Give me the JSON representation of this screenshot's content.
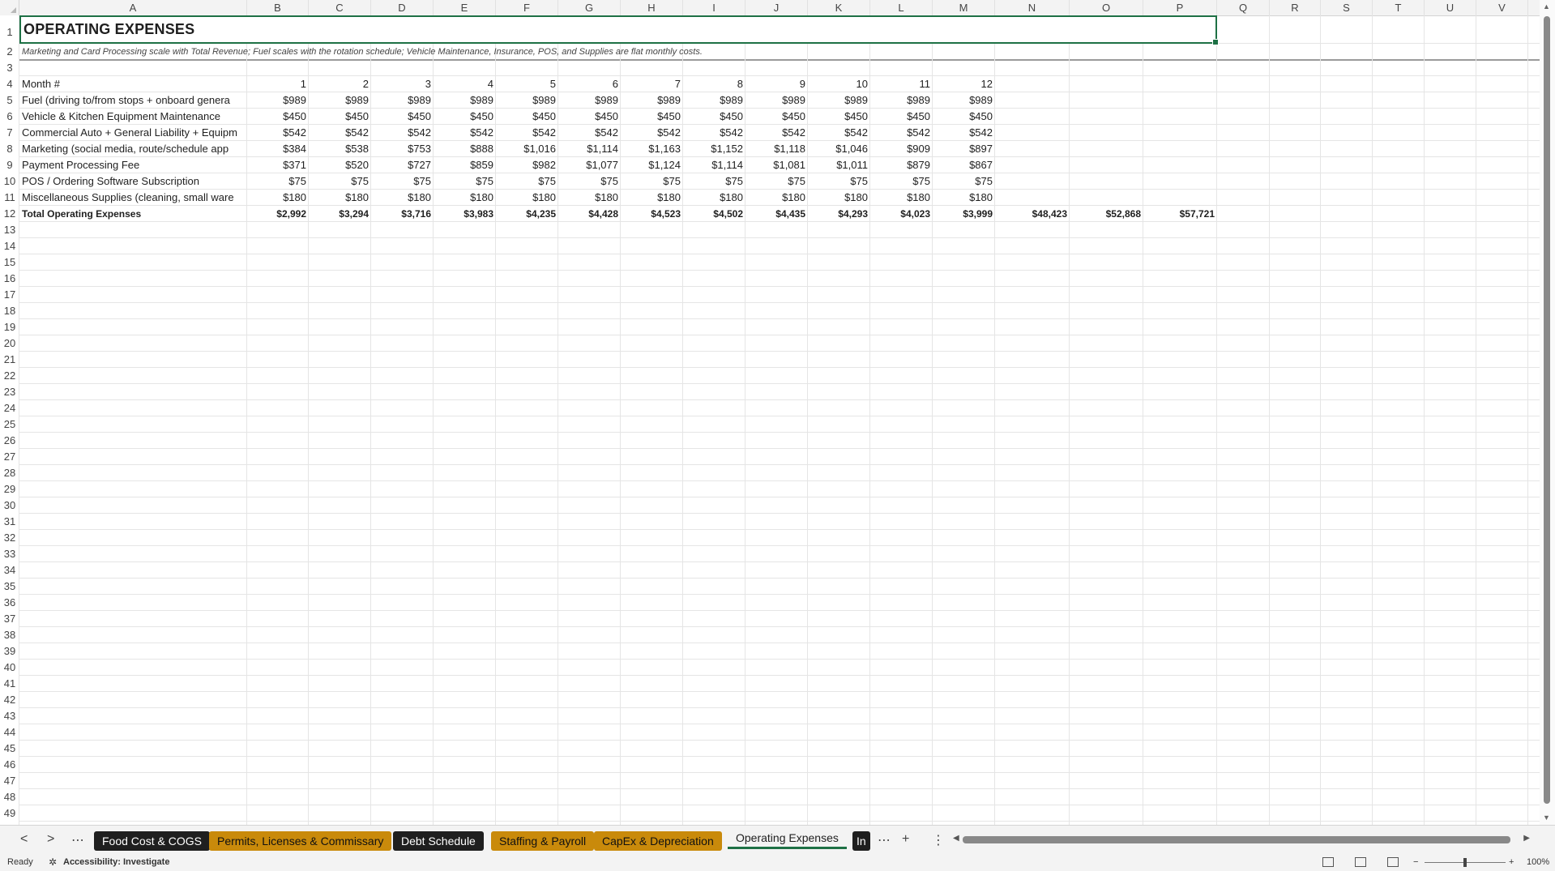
{
  "columns": [
    "A",
    "B",
    "C",
    "D",
    "E",
    "F",
    "G",
    "H",
    "I",
    "J",
    "K",
    "L",
    "M",
    "N",
    "O",
    "P",
    "Q",
    "R",
    "S",
    "T",
    "U",
    "V"
  ],
  "row_numbers": [
    1,
    2,
    3,
    4,
    5,
    6,
    7,
    8,
    9,
    10,
    11,
    12,
    13,
    14,
    15,
    16,
    17,
    18,
    19,
    20,
    21,
    22,
    23,
    24,
    25,
    26,
    27,
    28,
    29,
    30,
    31,
    32,
    33,
    34,
    35,
    36,
    37,
    38,
    39,
    40,
    41,
    42,
    43,
    44,
    45,
    46,
    47,
    48,
    49
  ],
  "sheet": {
    "title": "OPERATING EXPENSES",
    "subtitle": "Marketing and Card Processing scale with Total Revenue; Fuel scales with the rotation schedule; Vehicle Maintenance, Insurance, POS, and Supplies are flat monthly costs.",
    "header_label": "Month #",
    "months": [
      "1",
      "2",
      "3",
      "4",
      "5",
      "6",
      "7",
      "8",
      "9",
      "10",
      "11",
      "12"
    ],
    "rows": [
      {
        "label": "Fuel (driving to/from stops + onboard genera",
        "values": [
          "$989",
          "$989",
          "$989",
          "$989",
          "$989",
          "$989",
          "$989",
          "$989",
          "$989",
          "$989",
          "$989",
          "$989"
        ]
      },
      {
        "label": "Vehicle & Kitchen Equipment Maintenance",
        "values": [
          "$450",
          "$450",
          "$450",
          "$450",
          "$450",
          "$450",
          "$450",
          "$450",
          "$450",
          "$450",
          "$450",
          "$450"
        ]
      },
      {
        "label": "Commercial Auto + General Liability + Equipm",
        "values": [
          "$542",
          "$542",
          "$542",
          "$542",
          "$542",
          "$542",
          "$542",
          "$542",
          "$542",
          "$542",
          "$542",
          "$542"
        ]
      },
      {
        "label": "Marketing (social media, route/schedule app",
        "values": [
          "$384",
          "$538",
          "$753",
          "$888",
          "$1,016",
          "$1,114",
          "$1,163",
          "$1,152",
          "$1,118",
          "$1,046",
          "$909",
          "$897"
        ]
      },
      {
        "label": "Payment Processing Fee",
        "values": [
          "$371",
          "$520",
          "$727",
          "$859",
          "$982",
          "$1,077",
          "$1,124",
          "$1,114",
          "$1,081",
          "$1,011",
          "$879",
          "$867"
        ]
      },
      {
        "label": "POS / Ordering Software Subscription",
        "values": [
          "$75",
          "$75",
          "$75",
          "$75",
          "$75",
          "$75",
          "$75",
          "$75",
          "$75",
          "$75",
          "$75",
          "$75"
        ]
      },
      {
        "label": "Miscellaneous Supplies (cleaning, small ware",
        "values": [
          "$180",
          "$180",
          "$180",
          "$180",
          "$180",
          "$180",
          "$180",
          "$180",
          "$180",
          "$180",
          "$180",
          "$180"
        ]
      }
    ],
    "total": {
      "label": "Total Operating Expenses",
      "values": [
        "$2,992",
        "$3,294",
        "$3,716",
        "$3,983",
        "$4,235",
        "$4,428",
        "$4,523",
        "$4,502",
        "$4,435",
        "$4,293",
        "$4,023",
        "$3,999"
      ],
      "year_totals": [
        "$48,423",
        "$52,868",
        "$57,721"
      ]
    }
  },
  "tabs": {
    "prev": "<",
    "next": ">",
    "more_left": "⋯",
    "items": [
      {
        "label": "Food Cost & COGS",
        "style": "dark"
      },
      {
        "label": "Permits, Licenses & Commissary",
        "style": "gold"
      },
      {
        "label": "Debt Schedule",
        "style": "dark"
      },
      {
        "label": "Staffing & Payroll",
        "style": "gold"
      },
      {
        "label": "CapEx & Depreciation",
        "style": "gold"
      },
      {
        "label": "Operating Expenses",
        "style": "active"
      },
      {
        "label": "In",
        "style": "dark"
      }
    ],
    "more_right": "⋯",
    "add": "+",
    "options": "⋮"
  },
  "status": {
    "ready": "Ready",
    "accessibility": "Accessibility: Investigate",
    "zoom": "100%",
    "zoom_minus": "−",
    "zoom_plus": "+"
  },
  "colors": {
    "accent": "#1e7145",
    "gold_tab": "#c98a0b",
    "dark_tab": "#1f1f1f"
  }
}
